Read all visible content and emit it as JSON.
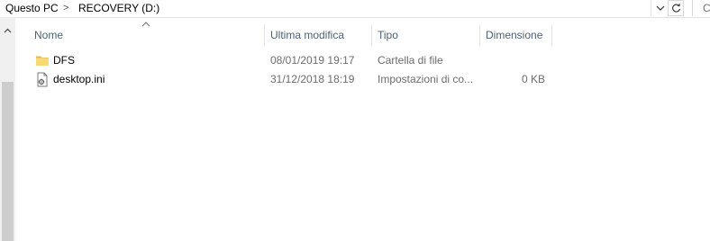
{
  "address_bar": {
    "crumbs": [
      "Questo PC",
      "RECOVERY (D:)"
    ],
    "separator": ">",
    "search_stub": "C"
  },
  "columns": {
    "name": "Nome",
    "date": "Ultima modifica",
    "type": "Tipo",
    "size": "Dimensione"
  },
  "sort": {
    "column": "name",
    "direction": "ascending"
  },
  "files": [
    {
      "name": "DFS",
      "date": "08/01/2019 19:17",
      "type": "Cartella di file",
      "size": "",
      "icon": "folder-icon"
    },
    {
      "name": "desktop.ini",
      "date": "31/12/2018 18:19",
      "type": "Impostazioni di co...",
      "size": "0 KB",
      "icon": "settings-file-icon"
    }
  ],
  "colors": {
    "header_text": "#4c607a",
    "detail_text": "#6d6d6d",
    "folder": "#f8d775"
  }
}
